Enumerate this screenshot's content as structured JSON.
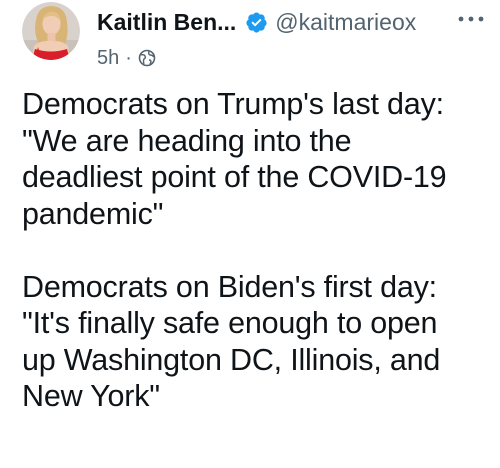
{
  "author": {
    "display_name": "Kaitlin Ben...",
    "handle": "@kaitmarieox",
    "verified": true
  },
  "meta": {
    "time": "5h",
    "separator": "·",
    "visibility_icon": "globe-icon"
  },
  "icons": {
    "more": "more-horizontal-icon",
    "verified": "verified-badge-icon"
  },
  "colors": {
    "verified_blue": "#1d9bf0",
    "secondary_text": "#536471",
    "primary_text": "#0f1419"
  },
  "tweet": {
    "paragraphs": [
      "Democrats on Trump's last day:\n\"We are heading into the\ndeadliest point of the COVID-19\npandemic\"",
      "Democrats on Biden's first day:\n\"It's finally safe enough to open\nup Washington DC, Illinois, and\nNew York\""
    ]
  }
}
